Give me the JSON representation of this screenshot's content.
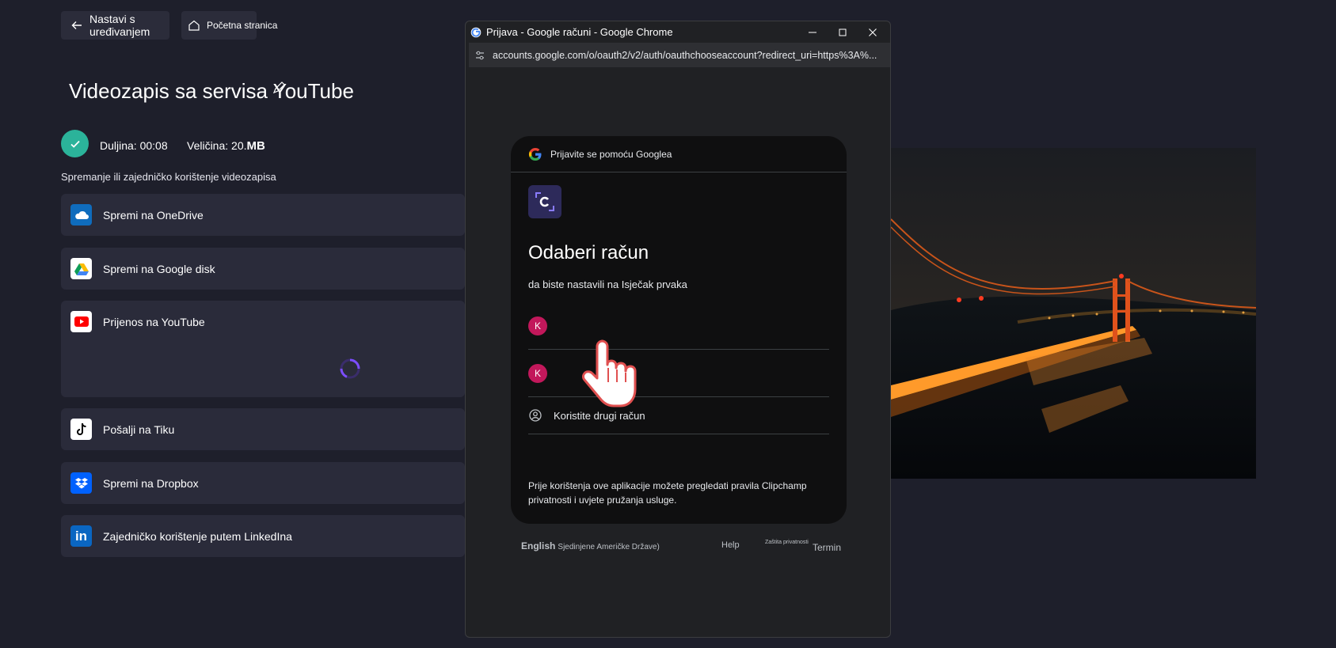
{
  "top_buttons": {
    "back_label": "Nastavi s uređivanjem",
    "home_label": "Početna stranica"
  },
  "export": {
    "title": "Videozapis sa servisa YouTube",
    "duration": "Duljina: 00:08",
    "size": "Veličina: 20.",
    "size_unit": "MB",
    "section_label": "Spremanje ili zajedničko korištenje videozapisa",
    "options": [
      {
        "label": "Spremi na OneDrive",
        "icon": "onedrive-icon"
      },
      {
        "label": "Spremi na Google disk",
        "icon": "google-drive-icon"
      },
      {
        "label": "Prijenos na YouTube",
        "icon": "youtube-icon",
        "state": "loading"
      },
      {
        "label": "Pošalji na Tiku",
        "icon": "tiktok-icon"
      },
      {
        "label": "Spremi na Dropbox",
        "icon": "dropbox-icon"
      },
      {
        "label": "Zajedničko korištenje putem LinkedIna",
        "icon": "linkedin-icon"
      }
    ]
  },
  "popup": {
    "window_title": "Prijava - Google računi - Google Chrome",
    "url": "accounts.google.com/o/oauth2/v2/auth/oauthchooseaccount?redirect_uri=https%3A%...",
    "card_header": "Prijavite se pomoću Googlea",
    "heading": "Odaberi račun",
    "subheading": "da biste nastavili na Isječak prvaka",
    "accounts": [
      {
        "initial": "K"
      },
      {
        "initial": "K"
      }
    ],
    "other_account": "Koristite drugi račun",
    "disclaimer": "Prije korištenja ove aplikacije možete pregledati pravila Clipchamp privatnosti i uvjete pružanja usluge.",
    "footer": {
      "language": "English",
      "region": "Sjedinjene Američke Države)",
      "help": "Help",
      "privacy": "Zaštita privatnosti",
      "terms": "Termin"
    }
  },
  "colors": {
    "background": "#1e1f2b",
    "option_bg": "#2a2b3a",
    "accent_check": "#2bb39a",
    "spinner": "#7c4dff",
    "avatar": "#c2185b"
  }
}
